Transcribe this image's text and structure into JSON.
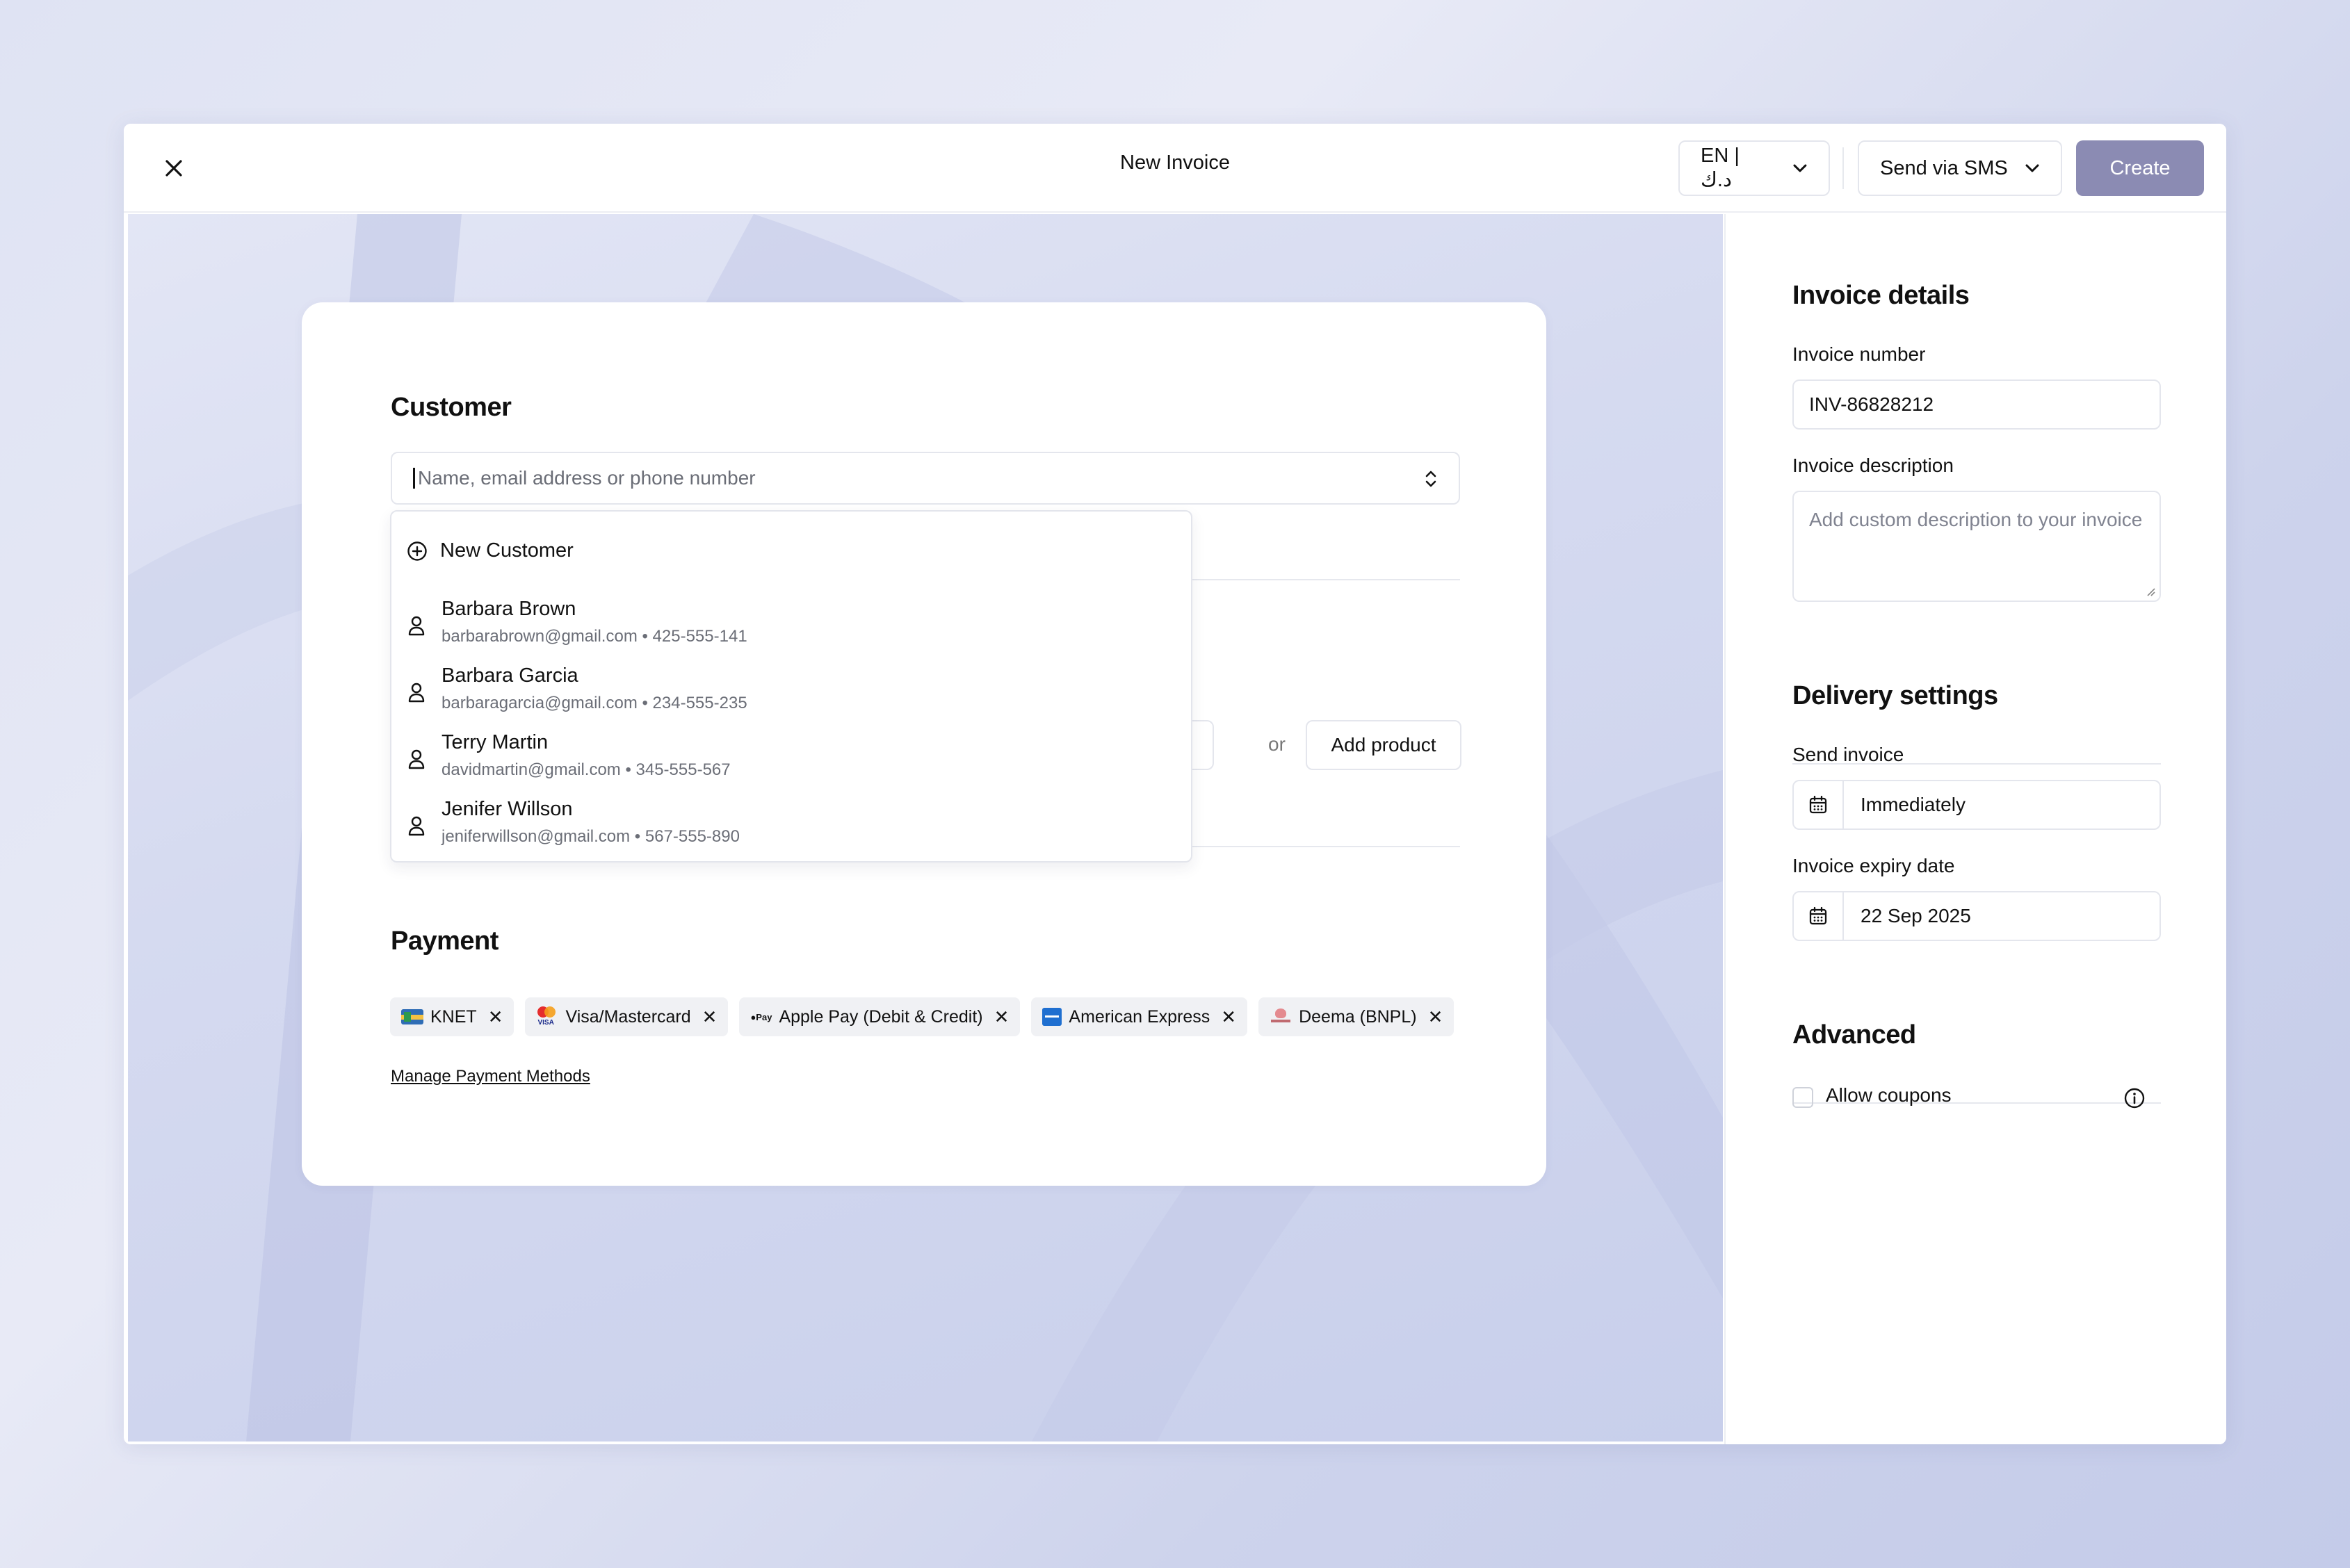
{
  "header": {
    "title": "New Invoice",
    "language_label": "EN | د.ك",
    "send_method_label": "Send via SMS",
    "create_label": "Create"
  },
  "customer": {
    "heading": "Customer",
    "search_placeholder": "Name, email address or phone number",
    "new_customer_label": "New Customer",
    "options": [
      {
        "name": "Barbara Brown",
        "detail": "barbarabrown@gmail.com • 425-555-141"
      },
      {
        "name": "Barbara Garcia",
        "detail": "barbaragarcia@gmail.com • 234-555-235"
      },
      {
        "name": "Terry Martin",
        "detail": "davidmartin@gmail.com • 345-555-567"
      },
      {
        "name": "Jenifer Willson",
        "detail": "jeniferwillson@gmail.com • 567-555-890"
      }
    ]
  },
  "products": {
    "or_label": "or",
    "add_product_label": "Add product"
  },
  "payment": {
    "heading": "Payment",
    "methods": [
      "KNET",
      "Visa/Mastercard",
      "Apple Pay (Debit & Credit)",
      "American Express",
      "Deema (BNPL)"
    ],
    "manage_label": "Manage Payment Methods"
  },
  "invoice_details": {
    "heading": "Invoice details",
    "number_label": "Invoice number",
    "number_value": "INV-86828212",
    "description_label": "Invoice description",
    "description_placeholder": "Add custom description to your invoice"
  },
  "delivery": {
    "heading": "Delivery settings",
    "send_label": "Send invoice",
    "send_value": "Immediately",
    "expiry_label": "Invoice expiry date",
    "expiry_value": "22 Sep 2025"
  },
  "advanced": {
    "heading": "Advanced",
    "allow_coupons_label": "Allow coupons"
  },
  "colors": {
    "create_button": "#8b8bb3",
    "background": "#d5daf0"
  }
}
